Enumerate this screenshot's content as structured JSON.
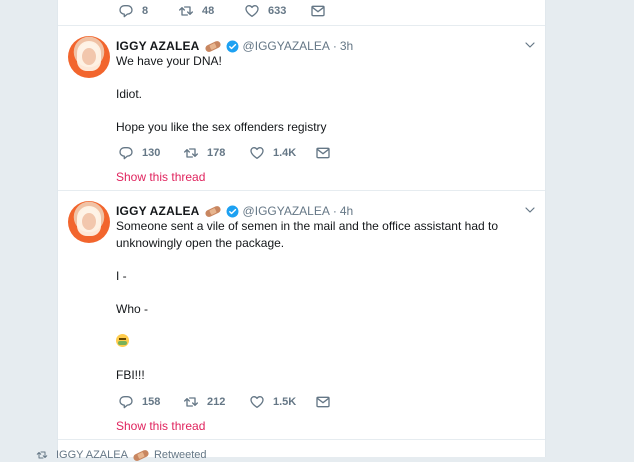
{
  "top_partial_tweet": {
    "replies": "8",
    "retweets": "48",
    "likes": "633"
  },
  "tweets": [
    {
      "name": "IGGY AZALEA",
      "handle": "@IGGYAZALEA",
      "time": "3h",
      "lines": [
        "We have your DNA!",
        "Idiot.",
        "Hope you like the sex offenders registry"
      ],
      "replies": "130",
      "retweets": "178",
      "likes": "1.4K",
      "thread_link": "Show this thread"
    },
    {
      "name": "IGGY AZALEA",
      "handle": "@IGGYAZALEA",
      "time": "4h",
      "lines": [
        "Someone sent a vile of semen in the mail and the office assistant had to",
        "unknowingly open the package.",
        "I -",
        "Who -",
        "FBI!!!"
      ],
      "emoji": "nauseated-face",
      "replies": "158",
      "retweets": "212",
      "likes": "1.5K",
      "thread_link": "Show this thread"
    }
  ],
  "retweeted_bar": {
    "name": "IGGY AZALEA",
    "label": "Retweeted"
  },
  "colors": {
    "background": "#e6ecf0",
    "text": "#14171a",
    "muted": "#657786",
    "link": "#e0245e",
    "verified": "#1da1f2"
  }
}
